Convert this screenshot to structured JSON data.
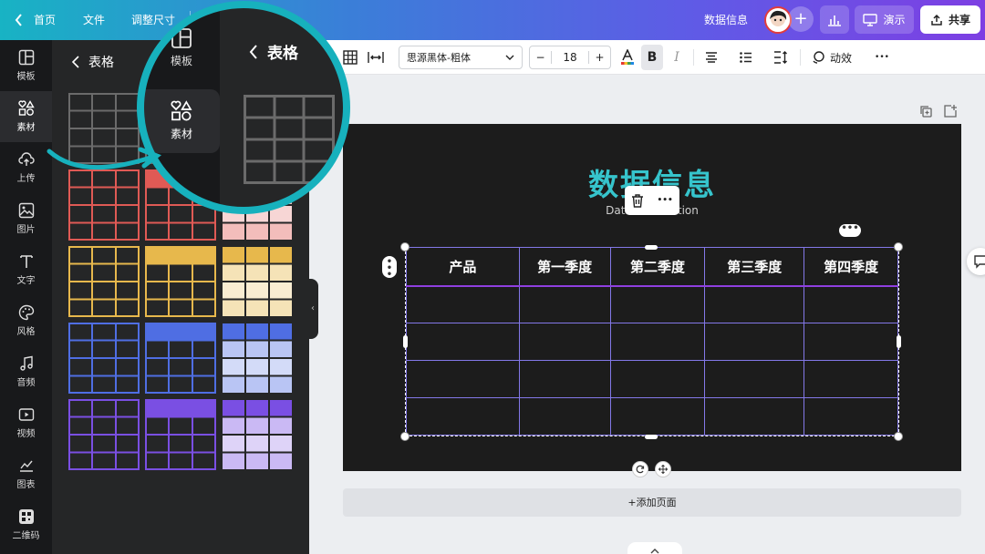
{
  "topbar": {
    "home_label": "首页",
    "file_label": "文件",
    "resize_label": "调整尺寸",
    "doc_title": "数据信息",
    "present_label": "演示",
    "share_label": "共享"
  },
  "rail": {
    "items": [
      {
        "label": "模板",
        "icon": "layout-icon"
      },
      {
        "label": "素材",
        "icon": "elements-icon"
      },
      {
        "label": "上传",
        "icon": "upload-cloud-icon"
      },
      {
        "label": "图片",
        "icon": "image-icon"
      },
      {
        "label": "文字",
        "icon": "text-icon"
      },
      {
        "label": "风格",
        "icon": "palette-icon"
      },
      {
        "label": "音频",
        "icon": "music-icon"
      },
      {
        "label": "视频",
        "icon": "video-icon"
      },
      {
        "label": "图表",
        "icon": "chart-icon"
      },
      {
        "label": "二维码",
        "icon": "qr-code-icon"
      }
    ]
  },
  "panel": {
    "title": "表格",
    "templates": [
      {
        "color": "#6b6b6b",
        "style": "plain"
      },
      {
        "color": "#6b6b6b",
        "style": "plain"
      },
      {
        "color": "#e05a55",
        "style": "plain"
      },
      {
        "color": "#e05a55",
        "style": "header"
      },
      {
        "color": "#e05a55",
        "style": "striped"
      },
      {
        "color": "#e7b84c",
        "style": "plain"
      },
      {
        "color": "#e7b84c",
        "style": "header"
      },
      {
        "color": "#e7b84c",
        "style": "striped"
      },
      {
        "color": "#4f6ee3",
        "style": "plain"
      },
      {
        "color": "#4f6ee3",
        "style": "header"
      },
      {
        "color": "#4f6ee3",
        "style": "striped"
      },
      {
        "color": "#7a4fe3",
        "style": "plain"
      },
      {
        "color": "#7a4fe3",
        "style": "header"
      },
      {
        "color": "#7a4fe3",
        "style": "striped"
      }
    ]
  },
  "toolbar": {
    "font_name": "思源黑体-粗体",
    "font_size": "18",
    "minus": "−",
    "plus": "+",
    "bold": "B",
    "italic": "I",
    "animate_label": "动效",
    "more": "•••"
  },
  "slide": {
    "title": "数据信息",
    "subtitle": "Data information",
    "table_headers": [
      "产品",
      "第一季度",
      "第二季度",
      "第三季度",
      "第四季度"
    ],
    "table_rows": [
      [
        "",
        "",
        "",
        "",
        ""
      ],
      [
        "",
        "",
        "",
        "",
        ""
      ],
      [
        "",
        "",
        "",
        "",
        ""
      ],
      [
        "",
        "",
        "",
        "",
        ""
      ]
    ]
  },
  "add_page_label": "+添加页面",
  "zoom": {
    "rail_items": [
      "模板",
      "素材"
    ],
    "title": "表格"
  },
  "colors": {
    "accent_teal": "#17b1bd",
    "table_border": "#8378e8",
    "header_underline": "#8f3fe0"
  }
}
